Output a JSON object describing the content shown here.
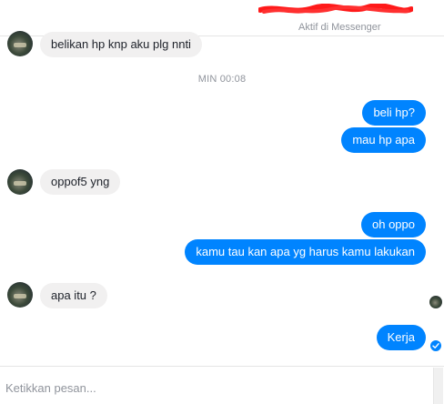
{
  "header": {
    "status": "Aktif di Messenger"
  },
  "messages": [
    {
      "side": "in",
      "text": "belikan hp knp aku plg nnti"
    },
    {
      "side": "out",
      "text": "beli hp?"
    },
    {
      "side": "out",
      "text": "mau hp apa"
    },
    {
      "side": "in",
      "text": "oppof5 yng"
    },
    {
      "side": "out",
      "text": "oh oppo"
    },
    {
      "side": "out",
      "text": "kamu tau kan apa yg harus kamu lakukan"
    },
    {
      "side": "in",
      "text": "apa itu ?"
    },
    {
      "side": "out",
      "text": "Kerja"
    }
  ],
  "timestamp": "MIN 00:08",
  "composer": {
    "placeholder": "Ketikkan pesan..."
  },
  "colors": {
    "outgoing_bubble": "#0084ff",
    "incoming_bubble": "#f1f0f0",
    "muted_text": "#90949c"
  }
}
